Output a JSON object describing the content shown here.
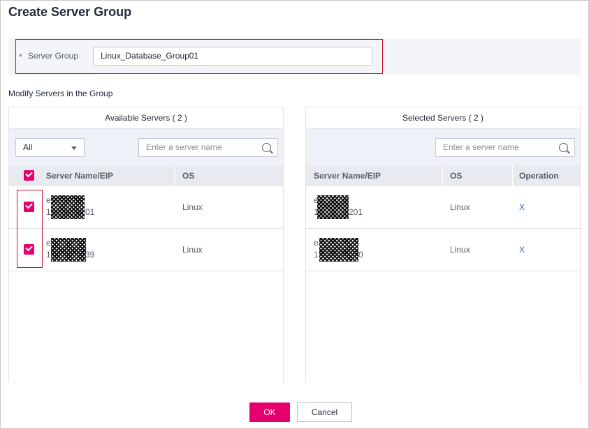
{
  "dialog": {
    "title": "Create Server Group"
  },
  "server_group": {
    "required_mark": "*",
    "label": "Server Group",
    "value": "Linux_Database_Group01"
  },
  "modify_label": "Modify Servers in the Group",
  "available": {
    "title": "Available Servers ( 2 )",
    "filter_value": "All",
    "search_placeholder": "Enter a server name",
    "columns": {
      "name": "Server Name/EIP",
      "os": "OS"
    },
    "rows": [
      {
        "name_prefix": "e",
        "eip_prefix": "1",
        "eip_suffix": "01",
        "os": "Linux",
        "checked": true
      },
      {
        "name_prefix": "e",
        "eip_prefix": "1",
        "eip_suffix": "39",
        "os": "Linux",
        "checked": true
      }
    ]
  },
  "selected": {
    "title": "Selected Servers ( 2 )",
    "search_placeholder": "Enter a server name",
    "columns": {
      "name": "Server Name/EIP",
      "os": "OS",
      "operation": "Operation"
    },
    "rows": [
      {
        "name_prefix": "e",
        "eip_prefix": "1",
        "eip_suffix": "201",
        "os": "Linux",
        "remove_label": "X"
      },
      {
        "name_prefix": "e",
        "eip_prefix": "1",
        "eip_suffix": "0",
        "os": "Linux",
        "remove_label": "X"
      }
    ]
  },
  "buttons": {
    "ok": "OK",
    "cancel": "Cancel"
  },
  "colors": {
    "accent": "#e6006e",
    "highlight_border": "#c8102e",
    "link": "#2a6bb9"
  }
}
